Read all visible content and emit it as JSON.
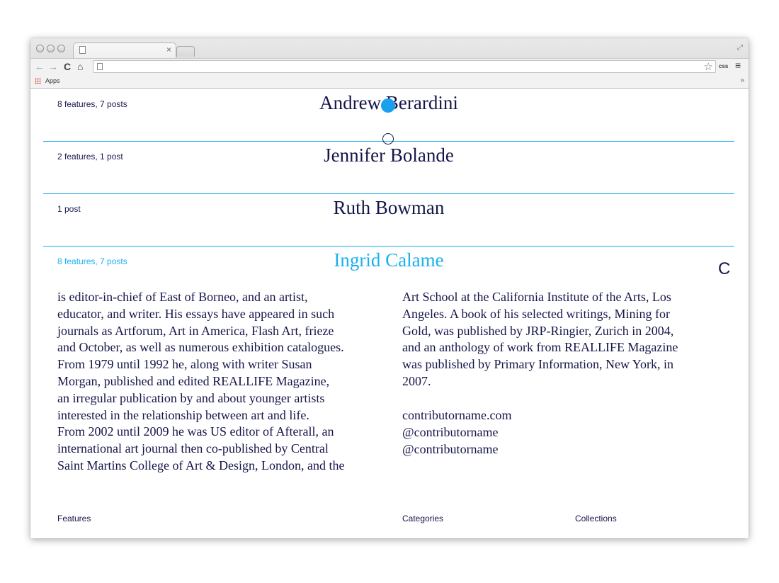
{
  "browser": {
    "bookmarks": {
      "apps_label": "Apps"
    },
    "extension_label": "css"
  },
  "contributors": [
    {
      "count": "8 features, 7 posts",
      "name": "Andrew Berardini"
    },
    {
      "count": "2 features, 1 post",
      "name": "Jennifer Bolande"
    },
    {
      "count": "1 post",
      "name": "Ruth Bowman"
    },
    {
      "count": "8 features, 7 posts",
      "name": "Ingrid Calame",
      "active": true
    }
  ],
  "expanded": {
    "close_label": "C",
    "bio_left": "is editor-in-chief of East of Borneo, and an artist,\neducator, and writer. His essays have appeared in such\njournals as Artforum, Art in America, Flash Art, frieze\nand October, as well as numerous exhibition catalogues.\nFrom 1979 until 1992 he, along with writer Susan\nMorgan, published and edited REALLIFE Magazine,\nan irregular publication by and about younger artists\ninterested in the relationship between art and life.\nFrom 2002 until 2009 he was US editor of Afterall, an\ninternational art journal then co-published by Central\nSaint Martins College of Art & Design, London, and the",
    "bio_right": "Art School at the California Institute of the Arts, Los\nAngeles. A book of his selected writings, Mining for\nGold, was published by JRP-Ringier, Zurich in 2004,\nand an anthology of work from REALLIFE Magazine\nwas published by Primary Information, New York, in\n2007.",
    "links": [
      "contributorname.com",
      "@contributorname",
      "@contributorname"
    ]
  },
  "footer": {
    "features": "Features",
    "categories": "Categories",
    "collections": "Collections"
  },
  "colors": {
    "accent": "#1ab0ee",
    "text": "#15154a"
  }
}
